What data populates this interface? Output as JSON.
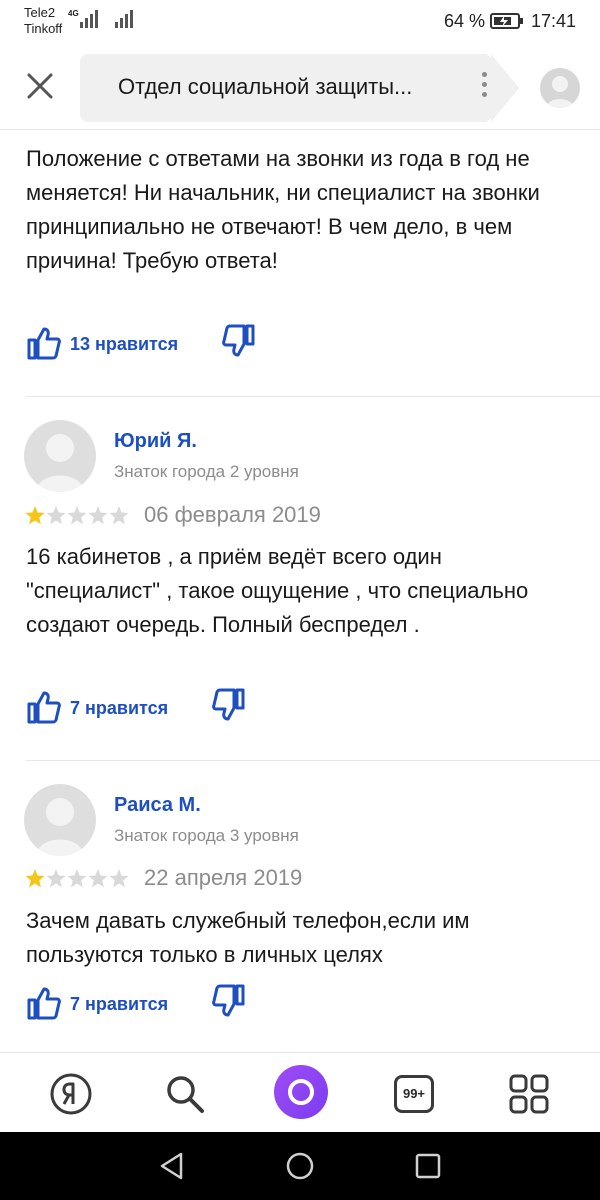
{
  "status_bar": {
    "carrier_1": "Tele2",
    "carrier_2": "Tinkoff",
    "network_type": "4G",
    "battery_percent": "64 %",
    "time": "17:41"
  },
  "header": {
    "title": "Отдел социальной защиты...",
    "close_icon": "close-icon",
    "menu_icon": "more-vertical-icon"
  },
  "reviews": [
    {
      "text": "Положение с ответами на звонки из года в год не меняется! Ни начальник, ни специалист на звонки принципиально не отвечают! В чем дело, в чем причина! Требую ответа!",
      "likes_label": "13 нравится"
    },
    {
      "author": "Юрий Я.",
      "level": "Знаток города 2 уровня",
      "rating": 1,
      "max_rating": 5,
      "date": "06 февраля 2019",
      "text": "16 кабинетов , а приём ведёт всего один \"специалист\" , такое ощущение , что специально создают очередь. Полный беспредел .",
      "likes_label": "7 нравится"
    },
    {
      "author": "Раиса М.",
      "level": "Знаток города 3 уровня",
      "rating": 1,
      "max_rating": 5,
      "date": "22 апреля 2019",
      "text": "Зачем давать служебный телефон,если им пользуются только в личных целях",
      "likes_label": "7 нравится"
    }
  ],
  "bottom_nav": {
    "items": [
      "yandex-icon",
      "search-icon",
      "alice-icon",
      "tabs-icon",
      "services-grid-icon"
    ],
    "tabs_count": "99+"
  },
  "colors": {
    "link_blue": "#1d4fc3",
    "star_gold": "#f5c518",
    "star_empty": "#d9d9d9",
    "alice_purple": "#8a44f2"
  }
}
